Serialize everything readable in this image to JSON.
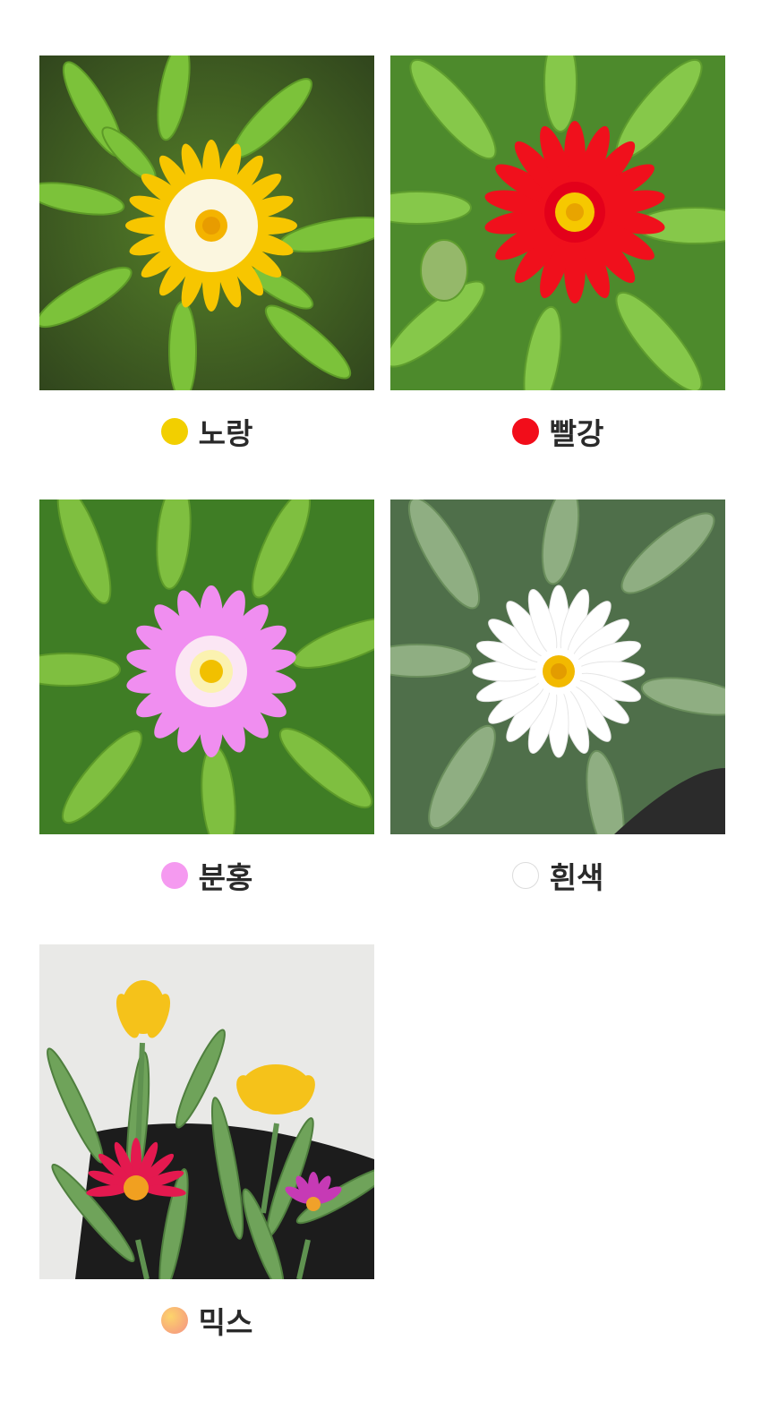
{
  "options": [
    {
      "label": "노랑",
      "swatch_color": "#f2cf00",
      "icon": "yellow-flower-photo"
    },
    {
      "label": "빨강",
      "swatch_color": "#f20d1a",
      "icon": "red-flower-photo"
    },
    {
      "label": "분홍",
      "swatch_color": "#f59af0",
      "icon": "pink-flower-photo"
    },
    {
      "label": "흰색",
      "swatch_color": "#ffffff",
      "icon": "white-flower-photo"
    },
    {
      "label": "믹스",
      "swatch_color": "#f7b27a",
      "icon": "mixed-flowers-photo"
    }
  ]
}
